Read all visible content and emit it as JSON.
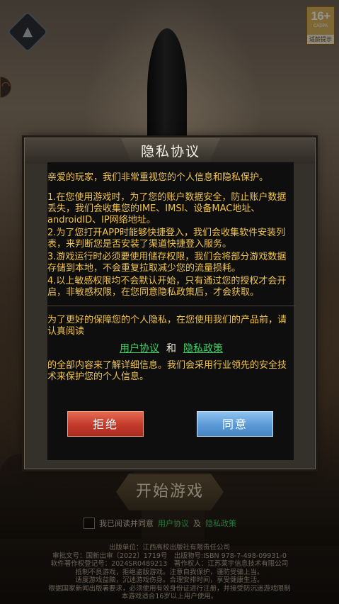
{
  "age_rating": {
    "label": "16+",
    "code": "CADPA",
    "tip": "适龄提示"
  },
  "privacy_dialog": {
    "title": "隐私协议",
    "intro": "亲爱的玩家，我们非常重视您的个人信息和隐私保护。",
    "items": [
      "1.在您使用游戏时，为了您的账户数据安全，防止账户数据丢失，我们会收集您的IME、IMSI、设备MAC地址、androidID、IP网络地址。",
      "2.为了您打开APP时能够快捷登入，我们会收集软件安装列表，来判断您是否安装了渠道快捷登入服务。",
      "3.游戏运行时必须要使用储存权限，我们会将部分游戏数据存储到本地，不会重复拉取减少您的流量损耗。",
      "4.以上敏感权限均不会默认开始，只有通过您的授权才会开启，非敏感权限，在您同意隐私政策后，才会获取。"
    ],
    "read_prompt": "为了更好的保障您的个人隐私，在您使用我们的产品前，请认真阅读",
    "user_agreement_link": "用户协议",
    "and": "和",
    "privacy_policy_link": "隐私政策",
    "closing": "的全部内容来了解详细信息。我们会采用行业领先的安全技术来保护您的个人信息。",
    "refuse_button": "拒绝",
    "agree_button": "同意"
  },
  "main_screen": {
    "start_button": "开始游戏",
    "agree_prefix": "我已阅读并同意",
    "agree_user_link": "用户协议",
    "agree_and": "及",
    "agree_privacy_link": "隐私政策"
  },
  "footer_lines": [
    "出版单位：江西高校出版社有限责任公司",
    "审批文号：国新出审〔2022〕1719号　出版物号:ISBN 978-7-498-09931-0",
    "软件著作权登记号：2024SR0489213　著作权人：江苏莱宇信息技术有限公司",
    "抵制不良游戏，拒绝盗版游戏。注意自我保护，谨防受骗上当。",
    "适度游戏益脑，沉迷游戏伤身。合理安排时间，享受健康生活。",
    "根据国家新闻出版署要求，必须使用有效身份证进行注册，并接受防沉迷游戏限制",
    "本游戏适合16岁以上用户使用。"
  ]
}
